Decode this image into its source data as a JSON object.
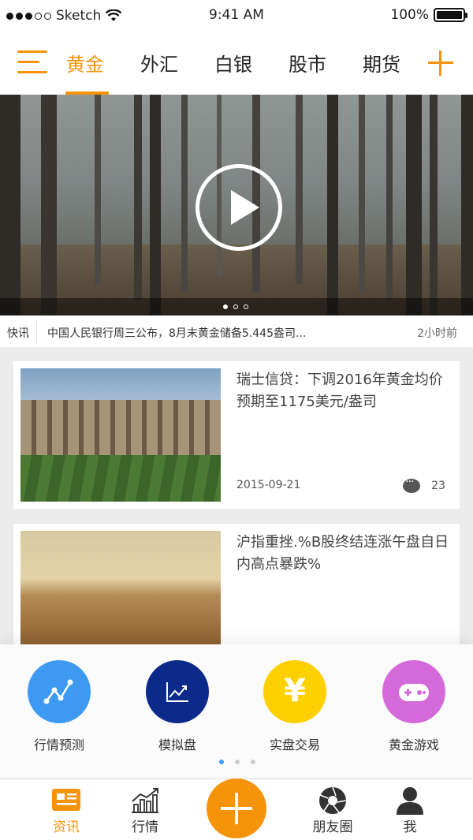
{
  "status_bar": {
    "carrier": "Sketch",
    "time": "9:41 AM",
    "battery": "100%"
  },
  "tabs": {
    "items": [
      "黄金",
      "外汇",
      "白银",
      "股市",
      "期货"
    ],
    "active_index": 0
  },
  "banner": {
    "page_count": 3,
    "active_page": 1
  },
  "ticker": {
    "label": "快讯",
    "text": "中国人民银行周三公布，8月末黄金储备5.445盎司...",
    "time_ago": "2小时前"
  },
  "articles": [
    {
      "title": "瑞士信贷：下调2016年黄金均价预期至1175美元/盎司",
      "date": "2015-09-21",
      "comments": "23"
    },
    {
      "title": "沪指重挫.%B股终结连涨午盘自日内高点暴跌%"
    }
  ],
  "quick_actions": [
    {
      "label": "行情预测",
      "color": "#3d9af0",
      "icon": "trend-line-icon"
    },
    {
      "label": "模拟盘",
      "color": "#0b2a8a",
      "icon": "chart-up-icon"
    },
    {
      "label": "实盘交易",
      "color": "#ffd000",
      "icon": "yen-icon",
      "glyph": "¥"
    },
    {
      "label": "黄金游戏",
      "color": "#d46ad9",
      "icon": "gamepad-icon"
    }
  ],
  "quick_actions_pager": {
    "page_count": 3,
    "active_page": 1
  },
  "bottom_nav": {
    "items": [
      {
        "label": "资讯",
        "icon": "news-icon"
      },
      {
        "label": "行情",
        "icon": "market-chart-icon"
      },
      {
        "label": "朋友圈",
        "icon": "aperture-icon"
      },
      {
        "label": "我",
        "icon": "user-icon"
      }
    ],
    "active_index": 0
  },
  "colors": {
    "accent": "#f5930a",
    "active_dot": "#3d9af0"
  }
}
